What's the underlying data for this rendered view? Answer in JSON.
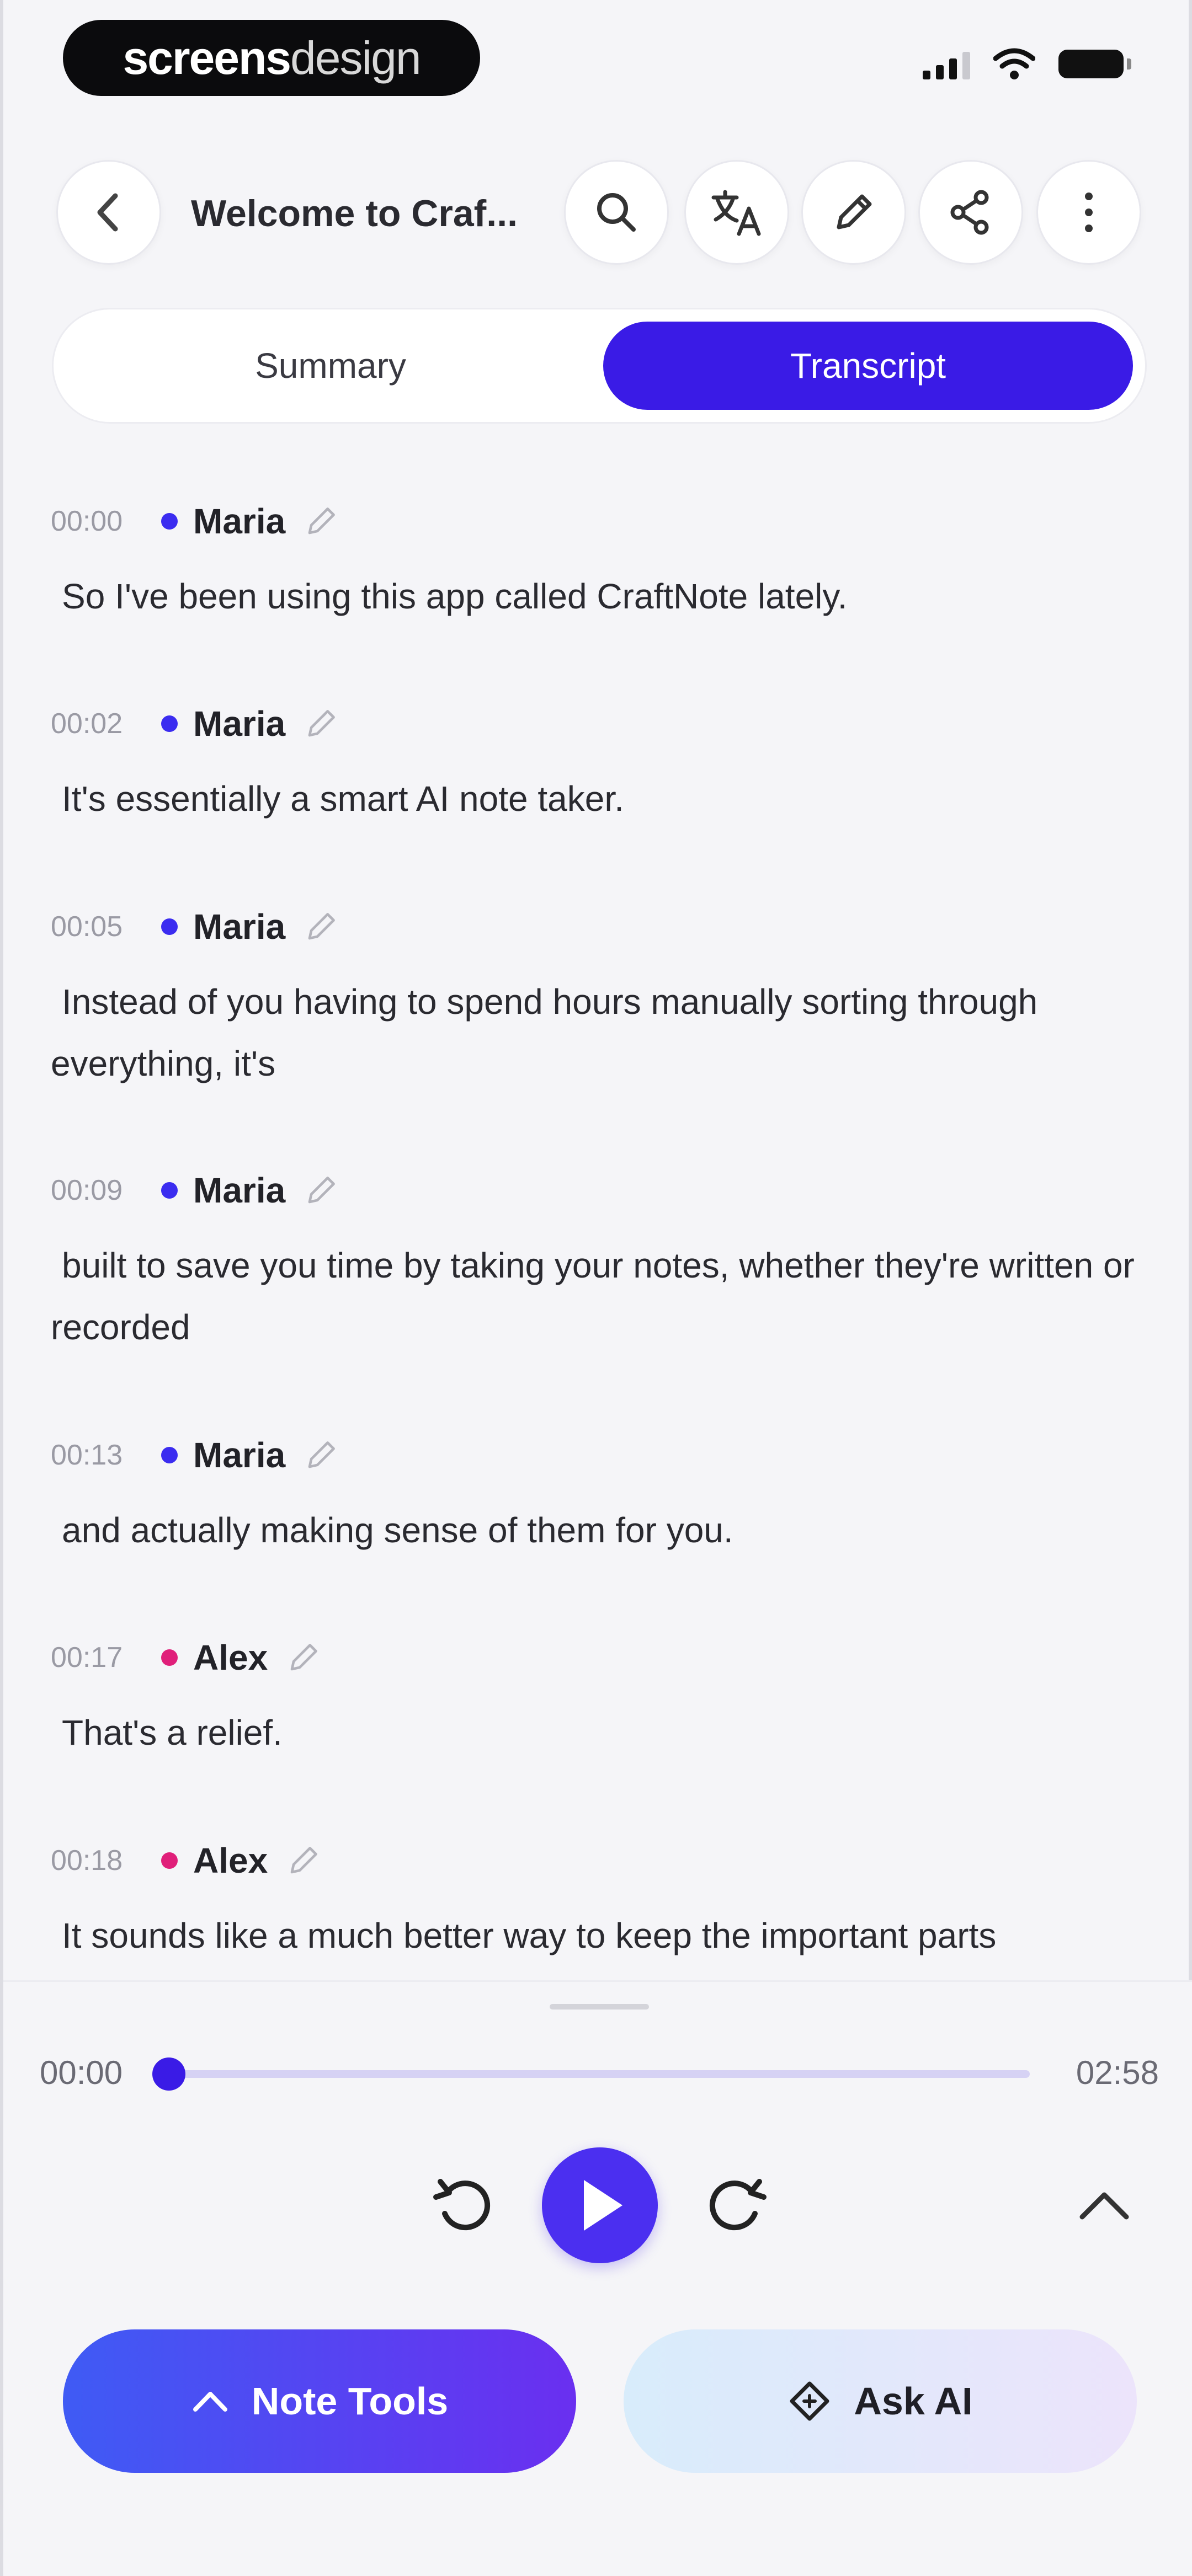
{
  "status_bar": {
    "brand_a": "screens",
    "brand_b": "design"
  },
  "header": {
    "title": "Welcome to Craf..."
  },
  "tabs": {
    "summary": "Summary",
    "transcript": "Transcript"
  },
  "transcript": [
    {
      "time": "00:00",
      "speaker": "Maria",
      "text": "So I've been using this app called CraftNote lately."
    },
    {
      "time": "00:02",
      "speaker": "Maria",
      "text": "It's essentially a smart AI note taker."
    },
    {
      "time": "00:05",
      "speaker": "Maria",
      "text": "Instead of you having to spend hours manually sorting through everything, it's"
    },
    {
      "time": "00:09",
      "speaker": "Maria",
      "text": "built to save you time by taking your notes, whether they're written or recorded"
    },
    {
      "time": "00:13",
      "speaker": "Maria",
      "text": "and actually making sense of them for you."
    },
    {
      "time": "00:17",
      "speaker": "Alex",
      "text": "That's a relief."
    },
    {
      "time": "00:18",
      "speaker": "Alex",
      "text": "It sounds like a much better way to keep the important parts"
    }
  ],
  "player": {
    "current": "00:00",
    "total": "02:58",
    "progress": 0.0
  },
  "actions": {
    "note_tools": "Note Tools",
    "ask_ai": "Ask AI"
  },
  "colors": {
    "accent": "#3a1be6",
    "maria": "#3b2cf0",
    "alex": "#e01f7a"
  }
}
